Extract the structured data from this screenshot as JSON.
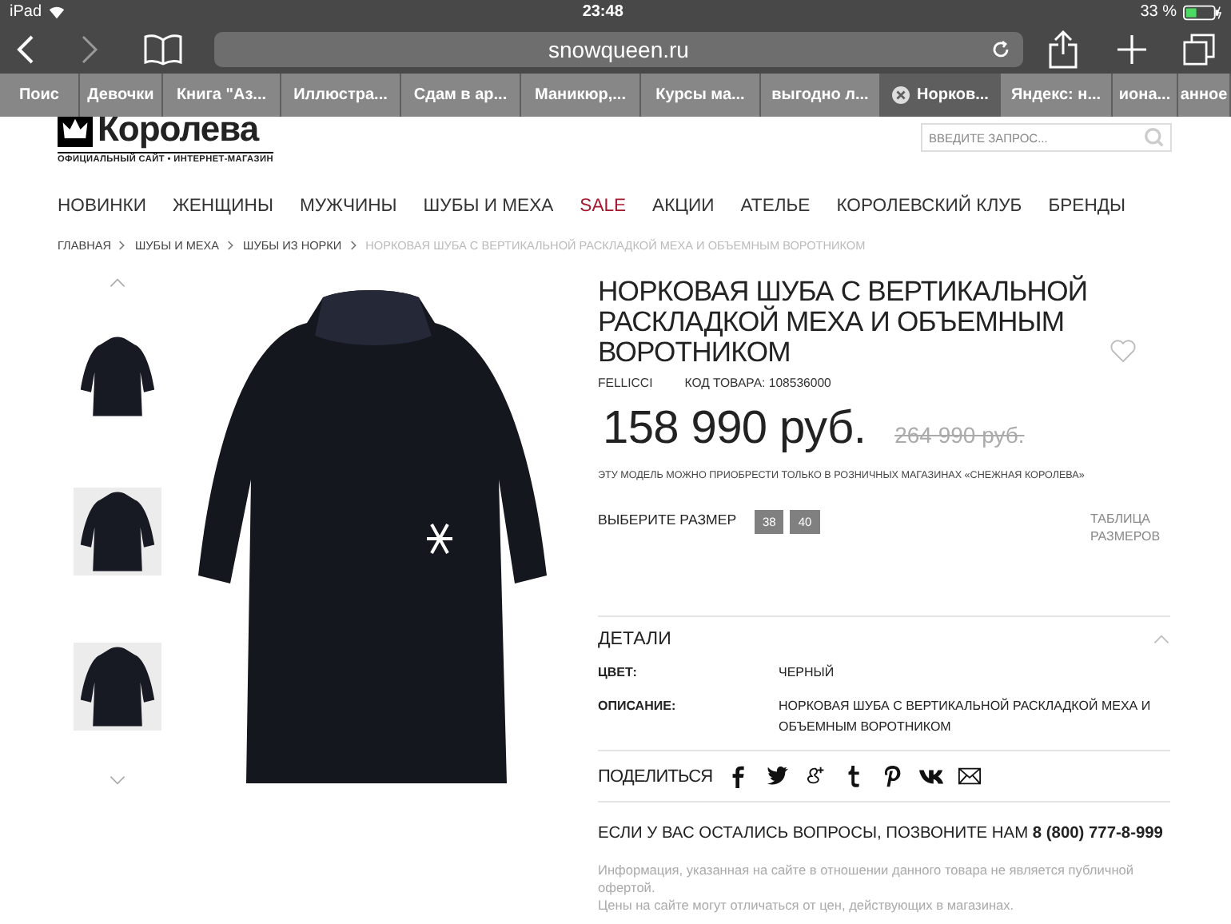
{
  "status_bar": {
    "device": "iPad",
    "time": "23:48",
    "battery": "33 %"
  },
  "address_bar": {
    "url": "snowqueen.ru"
  },
  "tabs": [
    {
      "label": "Поис",
      "selected": false
    },
    {
      "label": "Девочки",
      "selected": false
    },
    {
      "label": "Книга \"Аз...",
      "selected": false
    },
    {
      "label": "Иллюстра...",
      "selected": false
    },
    {
      "label": "Сдам в ар...",
      "selected": false
    },
    {
      "label": "Маникюр,...",
      "selected": false
    },
    {
      "label": "Курсы ма...",
      "selected": false
    },
    {
      "label": "выгодно л...",
      "selected": false
    },
    {
      "label": "Норков...",
      "selected": true
    },
    {
      "label": "Яндекс: н...",
      "selected": false
    },
    {
      "label": "иона...",
      "selected": false
    },
    {
      "label": "анное",
      "selected": false
    }
  ],
  "header": {
    "logo_name": "Королева",
    "logo_tagline": "ОФИЦИАЛЬНЫЙ САЙТ • ИНТЕРНЕТ-МАГАЗИН",
    "search": {
      "placeholder": "ВВЕДИТЕ ЗАПРОС..."
    }
  },
  "nav": [
    {
      "label": "НОВИНКИ",
      "kind": "normal"
    },
    {
      "label": "ЖЕНЩИНЫ",
      "kind": "normal"
    },
    {
      "label": "МУЖЧИНЫ",
      "kind": "normal"
    },
    {
      "label": "ШУБЫ И МЕХА",
      "kind": "normal"
    },
    {
      "label": "SALE",
      "kind": "sale"
    },
    {
      "label": "АКЦИИ",
      "kind": "normal"
    },
    {
      "label": "АТЕЛЬЕ",
      "kind": "normal"
    },
    {
      "label": "КОРОЛЕВСКИЙ КЛУБ",
      "kind": "normal"
    },
    {
      "label": "БРЕНДЫ",
      "kind": "normal"
    }
  ],
  "breadcrumbs": [
    {
      "label": "ГЛАВНАЯ",
      "kind": "link"
    },
    {
      "label": "ШУБЫ И МЕХА",
      "kind": "link"
    },
    {
      "label": "ШУБЫ ИЗ НОРКИ",
      "kind": "link"
    },
    {
      "label": "НОРКОВАЯ ШУБА С ВЕРТИКАЛЬНОЙ РАСКЛАДКОЙ МЕХА И ОБЪЕМНЫМ ВОРОТНИКОМ",
      "kind": "current"
    }
  ],
  "product": {
    "title": "НОРКОВАЯ ШУБА С ВЕРТИКАЛЬНОЙ РАСКЛАДКОЙ МЕХА И ОБЪЕМНЫМ ВОРОТНИКОМ",
    "brand": "FELLICCI",
    "code": "КОД ТОВАРА: 108536000",
    "price": "158 990 руб.",
    "old_price": "264 990 руб.",
    "notice": "ЭТУ МОДЕЛЬ МОЖНО ПРИОБРЕСТИ ТОЛЬКО В РОЗНИЧНЫХ МАГАЗИНАХ «СНЕЖНАЯ КОРОЛЕВА»",
    "size_label": "ВЫБЕРИТЕ РАЗМЕР",
    "sizes": [
      "38",
      "40"
    ],
    "size_table": "ТАБЛИЦА РАЗМЕРОВ"
  },
  "details": {
    "title": "ДЕТАЛИ",
    "expanded": true,
    "rows": [
      {
        "label": "ЦВЕТ:",
        "value": "ЧЕРНЫЙ"
      },
      {
        "label": "ОПИСАНИЕ:",
        "value": "НОРКОВАЯ ШУБА С ВЕРТИКАЛЬНОЙ РАСКЛАДКОЙ МЕХА И ОБЪЕМНЫМ ВОРОТНИКОМ"
      }
    ]
  },
  "share": {
    "label": "ПОДЕЛИТЬСЯ",
    "icons": [
      {
        "kind": "facebook"
      },
      {
        "kind": "twitter"
      },
      {
        "kind": "googleplus"
      },
      {
        "kind": "tumblr"
      },
      {
        "kind": "pinterest"
      },
      {
        "kind": "vk"
      },
      {
        "kind": "mail"
      }
    ]
  },
  "contact": "ЕСЛИ У ВАС ОСТАЛИСЬ ВОПРОСЫ, ПОЗВОНИТЕ НАМ **8 (800) 777-8-999**",
  "disclaimer": [
    "Информация, указанная на сайте в отношении данного товара не является публичной офертой.",
    "Цены на сайте могут отличаться от цен, действующих в магазинах."
  ]
}
